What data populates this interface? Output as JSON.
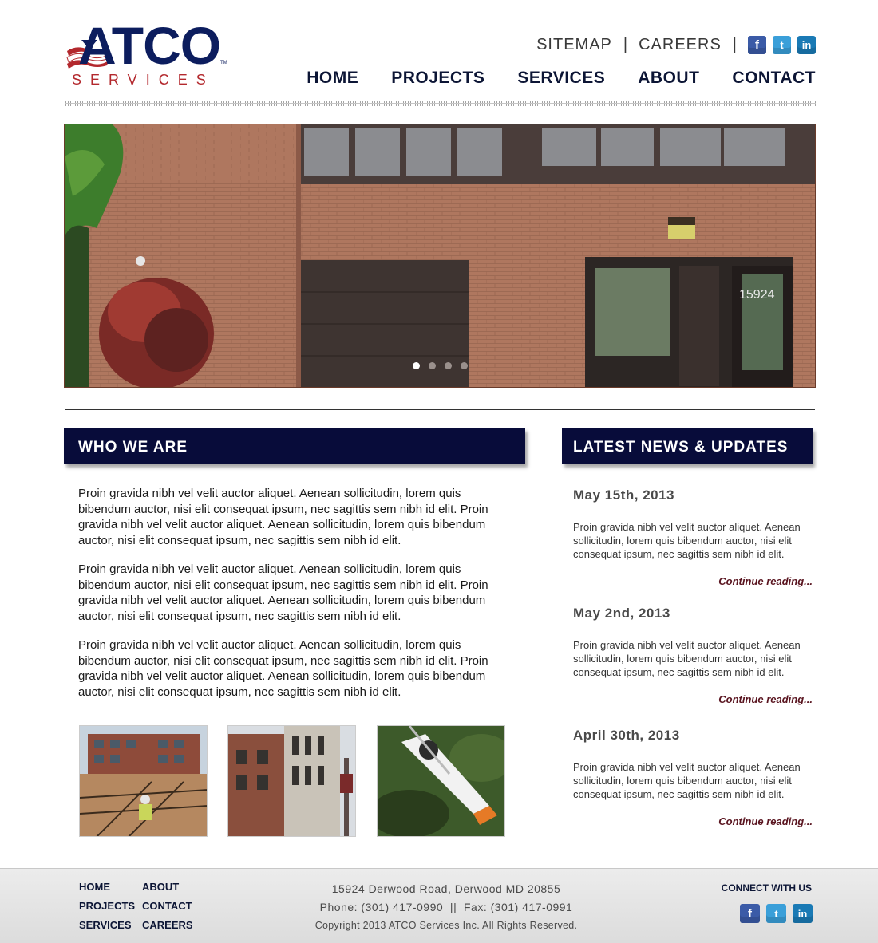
{
  "brand": {
    "name": "ATCO",
    "sub": "SERVICES",
    "tm": "TM"
  },
  "toplinks": {
    "sitemap": "SITEMAP",
    "careers": "CAREERS",
    "sep": "|"
  },
  "social": {
    "facebook": "f",
    "twitter": "t",
    "linkedin": "in"
  },
  "nav": [
    "HOME",
    "PROJECTS",
    "SERVICES",
    "ABOUT",
    "CONTACT"
  ],
  "hero": {
    "address_number": "15924",
    "slides": 4,
    "active_slide": 1
  },
  "who": {
    "title": "WHO WE ARE",
    "paragraphs": [
      "Proin gravida nibh vel velit auctor aliquet. Aenean sollicitudin, lorem quis bibendum auctor, nisi elit consequat ipsum, nec sagittis sem nibh id elit. Proin gravida nibh vel velit auctor aliquet. Aenean sollicitudin, lorem quis bibendum auctor, nisi elit consequat ipsum, nec sagittis sem nibh id elit.",
      "Proin gravida nibh vel velit auctor aliquet. Aenean sollicitudin, lorem quis bibendum auctor, nisi elit consequat ipsum, nec sagittis sem nibh id elit. Proin gravida nibh vel velit auctor aliquet. Aenean sollicitudin, lorem quis bibendum auctor, nisi elit consequat ipsum, nec sagittis sem nibh id elit.",
      "Proin gravida nibh vel velit auctor aliquet. Aenean sollicitudin, lorem quis bibendum auctor, nisi elit consequat ipsum, nec sagittis sem nibh id elit. Proin gravida nibh vel velit auctor aliquet. Aenean sollicitudin, lorem quis bibendum auctor, nisi elit consequat ipsum, nec sagittis sem nibh id elit."
    ]
  },
  "news": {
    "title": "LATEST NEWS & UPDATES",
    "items": [
      {
        "date": "May 15th, 2013",
        "text": "Proin gravida nibh vel velit auctor aliquet. Aenean sollicitudin, lorem quis bibendum auctor, nisi elit consequat ipsum, nec sagittis sem nibh id elit.",
        "more": "Continue reading..."
      },
      {
        "date": "May 2nd, 2013",
        "text": "Proin gravida nibh vel velit auctor aliquet. Aenean sollicitudin, lorem quis bibendum auctor, nisi elit consequat ipsum, nec sagittis sem nibh id elit.",
        "more": "Continue reading..."
      },
      {
        "date": "April 30th, 2013",
        "text": "Proin gravida nibh vel velit auctor aliquet. Aenean sollicitudin, lorem quis bibendum auctor, nisi elit consequat ipsum, nec sagittis sem nibh id elit.",
        "more": "Continue reading..."
      }
    ]
  },
  "footer": {
    "nav_col1": [
      "HOME",
      "PROJECTS",
      "SERVICES"
    ],
    "nav_col2": [
      "ABOUT",
      "CONTACT",
      "CAREERS"
    ],
    "address": "15924 Derwood Road, Derwood MD 20855",
    "phone": "Phone: (301) 417-0990  ||  Fax: (301) 417-0991",
    "copyright": "Copyright 2013 ATCO Services Inc. All Rights Reserved.",
    "connect": "CONNECT WITH US"
  },
  "colors": {
    "navy": "#080c3a",
    "brand_red": "#b3282d",
    "link_maroon": "#5a1520"
  }
}
